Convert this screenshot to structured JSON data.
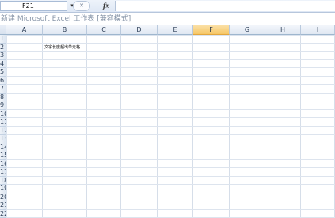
{
  "formula_bar": {
    "name_box": "F21",
    "dropdown_glyph": "▾",
    "cancel_glyph": "✕",
    "fx_label": "fx",
    "formula_value": ""
  },
  "title": "新建 Microsoft Excel 工作表 [兼容模式]",
  "columns": [
    "A",
    "B",
    "C",
    "D",
    "E",
    "F",
    "G",
    "H",
    "I"
  ],
  "selected_column": "F",
  "rows": [
    "1",
    "2",
    "3",
    "4",
    "5",
    "6",
    "7",
    "8",
    "9",
    "10",
    "11",
    "12",
    "13",
    "14",
    "15",
    "16",
    "17",
    "18",
    "19",
    "20",
    "21",
    "22"
  ],
  "cells": {
    "B2": "文字长度超出单元格"
  },
  "colors": {
    "selected_header": "#f6c664",
    "header": "#dfe7f2",
    "gridline": "#dbe3ee"
  },
  "icons": {
    "corner": "select-all-icon",
    "fx": "function-icon",
    "dropdown": "chevron-down-icon",
    "cancel": "close-icon"
  }
}
